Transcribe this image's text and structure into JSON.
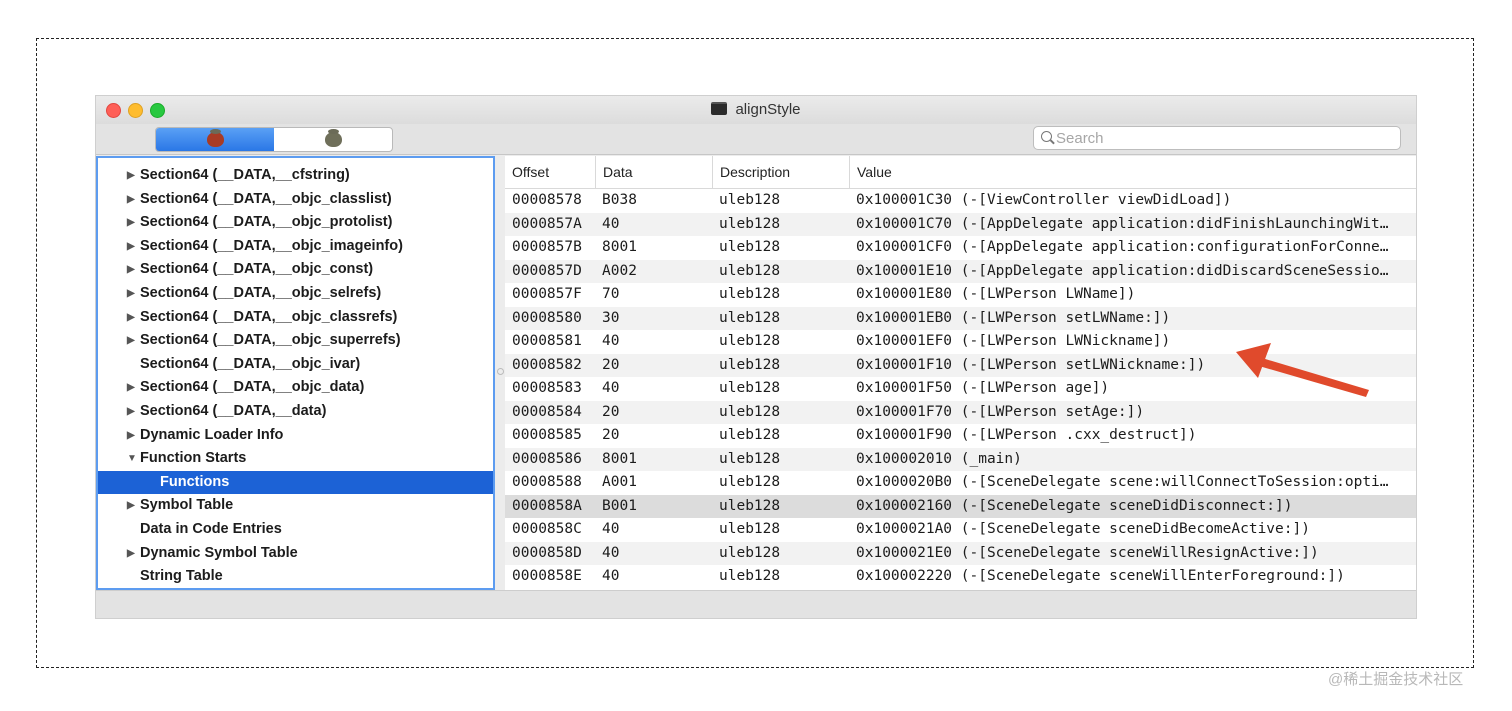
{
  "window": {
    "title": "alignStyle",
    "colors": {
      "accent": "#1c62d6",
      "close": "#fe5f57",
      "minimize": "#febc2e",
      "maximize": "#28c840",
      "annotation": "#e04a2c"
    }
  },
  "toolbar": {
    "segments": [
      {
        "icon": "bug-icon",
        "active": true
      },
      {
        "icon": "bug-icon",
        "active": false
      }
    ],
    "search_placeholder": "Search"
  },
  "tree": [
    {
      "label": "Section64 (__DATA,__cfstring)",
      "disclosure": "▶",
      "indent": 0
    },
    {
      "label": "Section64 (__DATA,__objc_classlist)",
      "disclosure": "▶",
      "indent": 0
    },
    {
      "label": "Section64 (__DATA,__objc_protolist)",
      "disclosure": "▶",
      "indent": 0
    },
    {
      "label": "Section64 (__DATA,__objc_imageinfo)",
      "disclosure": "▶",
      "indent": 0
    },
    {
      "label": "Section64 (__DATA,__objc_const)",
      "disclosure": "▶",
      "indent": 0
    },
    {
      "label": "Section64 (__DATA,__objc_selrefs)",
      "disclosure": "▶",
      "indent": 0
    },
    {
      "label": "Section64 (__DATA,__objc_classrefs)",
      "disclosure": "▶",
      "indent": 0
    },
    {
      "label": "Section64 (__DATA,__objc_superrefs)",
      "disclosure": "▶",
      "indent": 0
    },
    {
      "label": "Section64 (__DATA,__objc_ivar)",
      "disclosure": "",
      "indent": 0
    },
    {
      "label": "Section64 (__DATA,__objc_data)",
      "disclosure": "▶",
      "indent": 0
    },
    {
      "label": "Section64 (__DATA,__data)",
      "disclosure": "▶",
      "indent": 0
    },
    {
      "label": "Dynamic Loader Info",
      "disclosure": "▶",
      "indent": 0
    },
    {
      "label": "Function Starts",
      "disclosure": "▼",
      "indent": 0
    },
    {
      "label": "Functions",
      "disclosure": "",
      "indent": 1,
      "selected": true
    },
    {
      "label": "Symbol Table",
      "disclosure": "▶",
      "indent": 0
    },
    {
      "label": "Data in Code Entries",
      "disclosure": "",
      "indent": 0
    },
    {
      "label": "Dynamic Symbol Table",
      "disclosure": "▶",
      "indent": 0
    },
    {
      "label": "String Table",
      "disclosure": "",
      "indent": 0
    }
  ],
  "table": {
    "columns": [
      "Offset",
      "Data",
      "Description",
      "Value"
    ],
    "rows": [
      [
        "00008578",
        "B038",
        "uleb128",
        "0x100001C30 (-[ViewController viewDidLoad])"
      ],
      [
        "0000857A",
        "40",
        "uleb128",
        "0x100001C70 (-[AppDelegate application:didFinishLaunchingWit…"
      ],
      [
        "0000857B",
        "8001",
        "uleb128",
        "0x100001CF0 (-[AppDelegate application:configurationForConne…"
      ],
      [
        "0000857D",
        "A002",
        "uleb128",
        "0x100001E10 (-[AppDelegate application:didDiscardSceneSessio…"
      ],
      [
        "0000857F",
        "70",
        "uleb128",
        "0x100001E80 (-[LWPerson LWName])"
      ],
      [
        "00008580",
        "30",
        "uleb128",
        "0x100001EB0 (-[LWPerson setLWName:])"
      ],
      [
        "00008581",
        "40",
        "uleb128",
        "0x100001EF0 (-[LWPerson LWNickname])"
      ],
      [
        "00008582",
        "20",
        "uleb128",
        "0x100001F10 (-[LWPerson setLWNickname:])"
      ],
      [
        "00008583",
        "40",
        "uleb128",
        "0x100001F50 (-[LWPerson age])"
      ],
      [
        "00008584",
        "20",
        "uleb128",
        "0x100001F70 (-[LWPerson setAge:])"
      ],
      [
        "00008585",
        "20",
        "uleb128",
        "0x100001F90 (-[LWPerson .cxx_destruct])"
      ],
      [
        "00008586",
        "8001",
        "uleb128",
        "0x100002010 (_main)"
      ],
      [
        "00008588",
        "A001",
        "uleb128",
        "0x1000020B0 (-[SceneDelegate scene:willConnectToSession:opti…"
      ],
      [
        "0000858A",
        "B001",
        "uleb128",
        "0x100002160 (-[SceneDelegate sceneDidDisconnect:])"
      ],
      [
        "0000858C",
        "40",
        "uleb128",
        "0x1000021A0 (-[SceneDelegate sceneDidBecomeActive:])"
      ],
      [
        "0000858D",
        "40",
        "uleb128",
        "0x1000021E0 (-[SceneDelegate sceneWillResignActive:])"
      ],
      [
        "0000858E",
        "40",
        "uleb128",
        "0x100002220 (-[SceneDelegate sceneWillEnterForeground:])"
      ]
    ],
    "highlighted_row": 13
  },
  "watermark": "@稀土掘金技术社区"
}
